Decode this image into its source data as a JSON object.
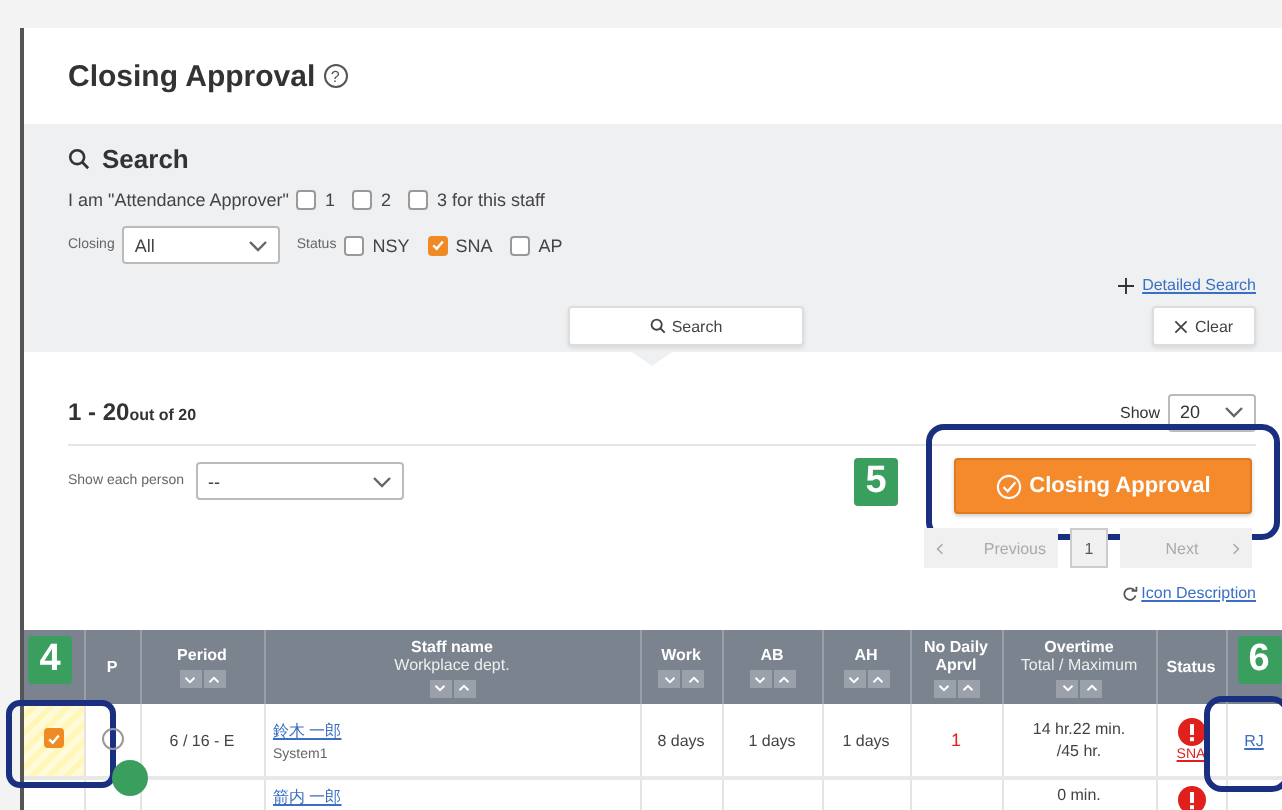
{
  "title": "Closing Approval",
  "help_mark": "?",
  "search": {
    "heading": "Search",
    "approver_label": "I am \"Attendance Approver\"",
    "approver_options": [
      {
        "label": "1",
        "checked": false
      },
      {
        "label": "2",
        "checked": false
      },
      {
        "label": "3 for this staff",
        "checked": false
      }
    ],
    "closing_label": "Closing",
    "closing_value": "All",
    "status_label": "Status",
    "status_options": [
      {
        "label": "NSY",
        "checked": false
      },
      {
        "label": "SNA",
        "checked": true
      },
      {
        "label": "AP",
        "checked": false
      }
    ],
    "detailed_link": "Detailed Search",
    "search_button": "Search",
    "clear_button": "Clear"
  },
  "results": {
    "range": "1 - 20",
    "total": "out of 20",
    "show_label": "Show",
    "show_value": "20",
    "person_label": "Show each person",
    "person_value": "--",
    "approve_button": "Closing Approval",
    "badge": "5",
    "pagination": {
      "previous": "Previous",
      "pages": [
        {
          "label": "1",
          "selected": true
        }
      ],
      "next": "Next"
    },
    "icon_description": "Icon Description"
  },
  "table": {
    "columns": [
      {
        "kind": "badge",
        "label": "4"
      },
      {
        "kind": "text",
        "label": "P",
        "sortable": false
      },
      {
        "kind": "text",
        "label": "Period",
        "sortable": true
      },
      {
        "kind": "text",
        "label": "Staff name",
        "sub": "Workplace dept.",
        "sortable": true
      },
      {
        "kind": "text",
        "label": "Work",
        "sortable": true
      },
      {
        "kind": "text",
        "label": "AB",
        "sortable": true
      },
      {
        "kind": "text",
        "label": "AH",
        "sortable": true
      },
      {
        "kind": "text",
        "label": "No Daily Aprvl",
        "sortable": true
      },
      {
        "kind": "text",
        "label": "Overtime",
        "sub": "Total / Maximum",
        "sortable": true
      },
      {
        "kind": "text",
        "label": "Status",
        "sortable": false
      },
      {
        "kind": "badge",
        "label": "6"
      }
    ],
    "rows": [
      {
        "checked": true,
        "period": "6 / 16 - E",
        "name": "鈴木 一郎",
        "dept": "System1",
        "work": "8 days",
        "ab": "1 days",
        "ah": "1 days",
        "no_daily": "1",
        "overtime": "14 hr.22 min.",
        "maximum": "/45 hr.",
        "status": "SNA",
        "action": "RJ"
      },
      {
        "name": "箭内 一郎",
        "overtime": "0 min.",
        "status_alert": true
      }
    ]
  }
}
